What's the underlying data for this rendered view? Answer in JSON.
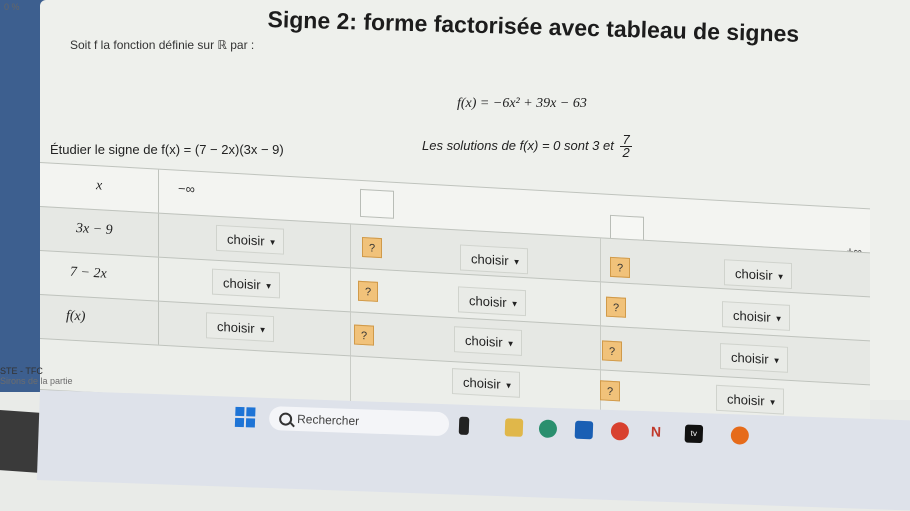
{
  "status_bar": {
    "text": "0 %"
  },
  "page": {
    "title": "Signe 2: forme factorisée avec tableau de signes",
    "intro_text": "Soit f la fonction définie sur ℝ par :",
    "formula": "f(x) = −6x² + 39x − 63",
    "solutions_text": "Les solutions de f(x) = 0 sont 3 et",
    "solutions_fraction": {
      "num": "7",
      "den": "2"
    },
    "study_text": "Étudier le signe de f(x) = (7 − 2x)(3x − 9)"
  },
  "table": {
    "header_labels": [
      "x",
      "3x − 9",
      "7 − 2x",
      "f(x)"
    ],
    "minus_infinity": "−∞",
    "plus_infinity": "+∞",
    "select_label": "choisir",
    "question_mark": "?"
  },
  "bottom_left": {
    "line1": "STE - TFC",
    "line2": "Sirons de la partie"
  },
  "taskbar": {
    "search_label": "Rechercher"
  },
  "colors": {
    "accent_orange": "#f1c27a",
    "windows_blue": "#1e74d6"
  }
}
